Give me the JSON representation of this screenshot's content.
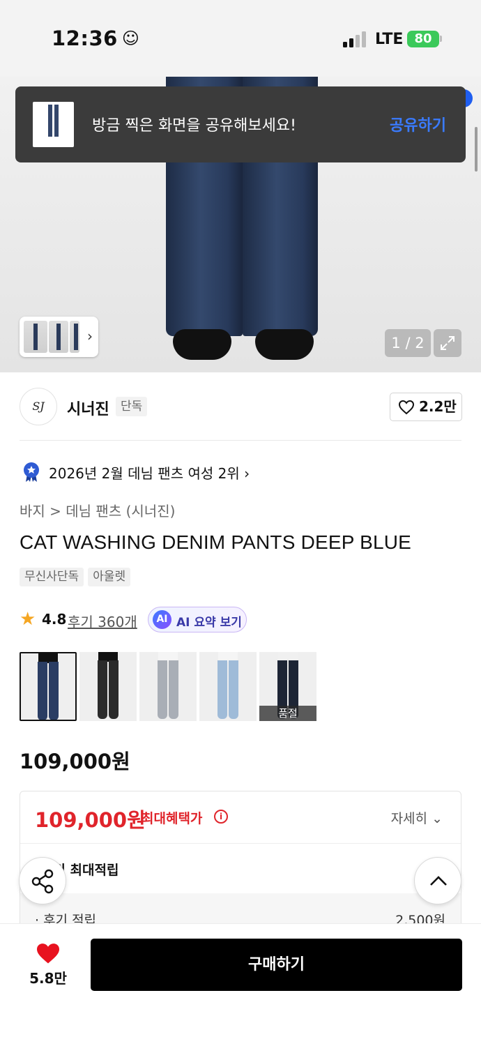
{
  "status_bar": {
    "time": "12:36",
    "network": "LTE",
    "battery": "80"
  },
  "toast": {
    "message": "방금 찍은 화면을 공유해보세요!",
    "action": "공유하기"
  },
  "gallery": {
    "counter": "1 / 2"
  },
  "brand": {
    "name": "시너진",
    "badge": "단독",
    "logo_text": "SJ",
    "like_count": "2.2만"
  },
  "ranking": {
    "text": "2026년 2월 데님 팬츠 여성 2위"
  },
  "breadcrumb": "바지 > 데님 팬츠 (시너진)",
  "product": {
    "title": "CAT WASHING DENIM PANTS DEEP BLUE",
    "tags": [
      "무신사단독",
      "아울렛"
    ],
    "rating": "4.8",
    "reviews": "후기 360개",
    "ai_summary": "AI 요약 보기",
    "ai_logo": "AI",
    "price": "109,000원"
  },
  "colors": [
    {
      "name": "deep-blue",
      "color": "#2a3d63",
      "top": "#111111",
      "selected": true
    },
    {
      "name": "black",
      "color": "#2b2b2b",
      "top": "#111111",
      "selected": false
    },
    {
      "name": "light-grey",
      "color": "#a9aeb6",
      "top": "#f5f5f5",
      "selected": false
    },
    {
      "name": "light-blue",
      "color": "#9fbbd8",
      "top": "#f5f5f5",
      "selected": false
    },
    {
      "name": "dark-navy",
      "color": "#1d2535",
      "top": "#f0f0f0",
      "selected": false,
      "status": "품절"
    }
  ],
  "benefit": {
    "max_price": "109,000원",
    "max_label": "최대혜택가",
    "detail": "자세히",
    "points": "00원 최대적립",
    "review_label": "· 후기 적립",
    "review_value": "2,500원"
  },
  "bottom": {
    "wish_count": "5.8만",
    "buy_label": "구매하기"
  },
  "theme": {
    "accent_red": "#e0242b",
    "accent_blue": "#3a7bff",
    "rating_star": "#f5a623"
  }
}
